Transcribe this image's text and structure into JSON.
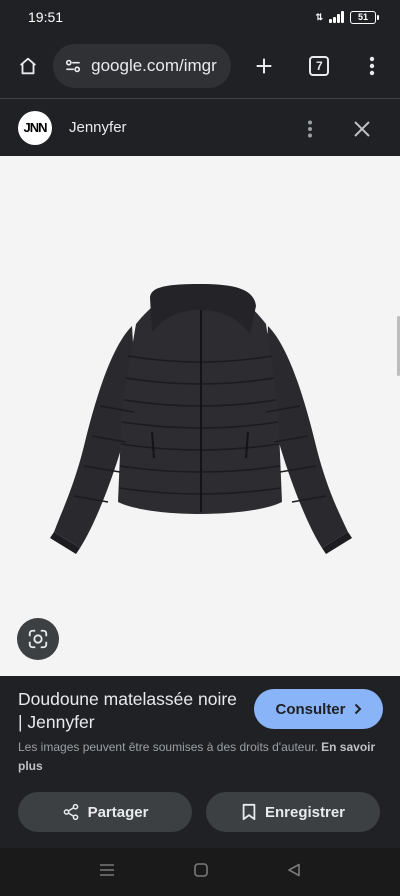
{
  "status_bar": {
    "time": "19:51",
    "battery": "51"
  },
  "toolbar": {
    "url": "google.com/imgr",
    "tab_count": "7"
  },
  "site": {
    "logo_text": "JNN",
    "name": "Jennyfer"
  },
  "result": {
    "title": "Doudoune matelassée noire | Jennyfer",
    "visit_label": "Consulter",
    "copyright_text": "Les images peuvent être soumises à des droits d'auteur.",
    "learn_more": "En savoir plus",
    "share_label": "Partager",
    "save_label": "Enregistrer"
  },
  "colors": {
    "background": "#202124",
    "accent": "#8ab4f8",
    "button_bg": "#3c4043",
    "image_bg": "#f4f4f4"
  },
  "icons": {
    "home": "home-icon",
    "tune": "site-settings-icon",
    "new_tab": "plus-icon",
    "tabs": "tab-switcher-icon",
    "menu": "more-vert-icon",
    "close": "close-icon",
    "lens": "google-lens-icon",
    "share": "share-icon",
    "bookmark": "bookmark-icon",
    "chevron": "chevron-right-icon"
  }
}
